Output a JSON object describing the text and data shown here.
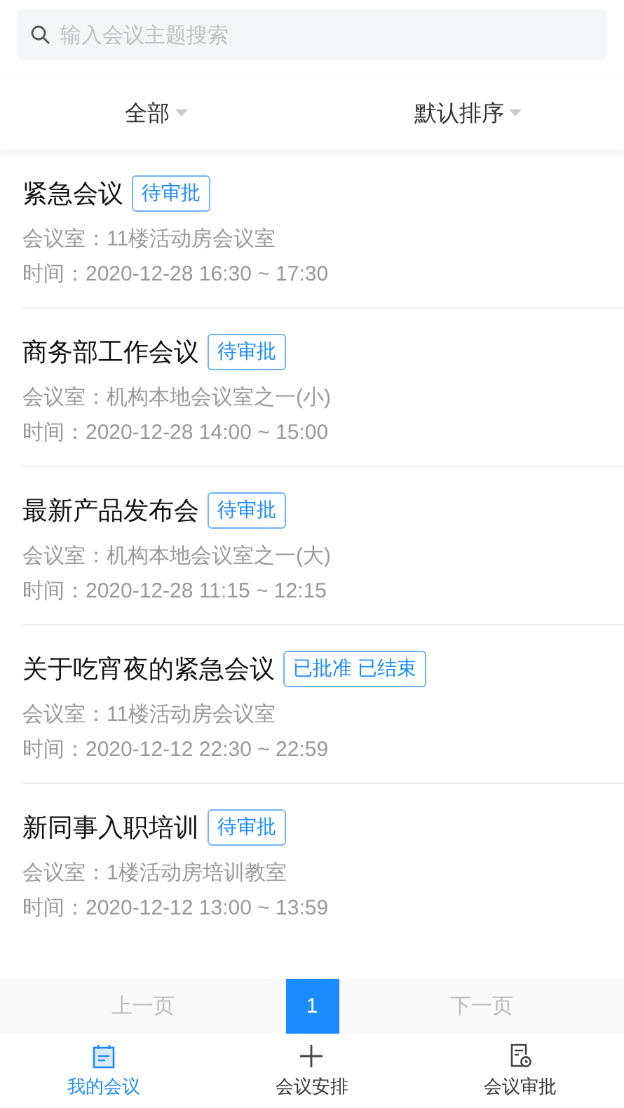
{
  "search": {
    "placeholder": "输入会议主题搜索"
  },
  "filters": [
    {
      "label": "全部"
    },
    {
      "label": "默认排序"
    }
  ],
  "meetings": [
    {
      "title": "紧急会议",
      "tag": "待审批",
      "room": "会议室：11楼活动房会议室",
      "time": "时间：2020-12-28 16:30 ~ 17:30"
    },
    {
      "title": "商务部工作会议",
      "tag": "待审批",
      "room": "会议室：机构本地会议室之一(小)",
      "time": "时间：2020-12-28 14:00 ~ 15:00"
    },
    {
      "title": "最新产品发布会",
      "tag": "待审批",
      "room": "会议室：机构本地会议室之一(大)",
      "time": "时间：2020-12-28 11:15 ~ 12:15"
    },
    {
      "title": "关于吃宵夜的紧急会议",
      "tag": "已批准 已结束",
      "room": "会议室：11楼活动房会议室",
      "time": "时间：2020-12-12 22:30 ~ 22:59"
    },
    {
      "title": "新同事入职培训",
      "tag": "待审批",
      "room": "会议室：1楼活动房培训教室",
      "time": "时间：2020-12-12 13:00 ~ 13:59"
    }
  ],
  "pagination": {
    "prev": {
      "label": "上一页",
      "disabled": true
    },
    "pages": [
      {
        "label": "1",
        "selected": true
      }
    ],
    "next": {
      "label": "下一页",
      "disabled": true
    }
  },
  "tabbar": [
    {
      "label": "我的会议",
      "selected": true
    },
    {
      "label": "会议安排",
      "selected": false
    },
    {
      "label": "会议审批",
      "selected": false
    }
  ]
}
